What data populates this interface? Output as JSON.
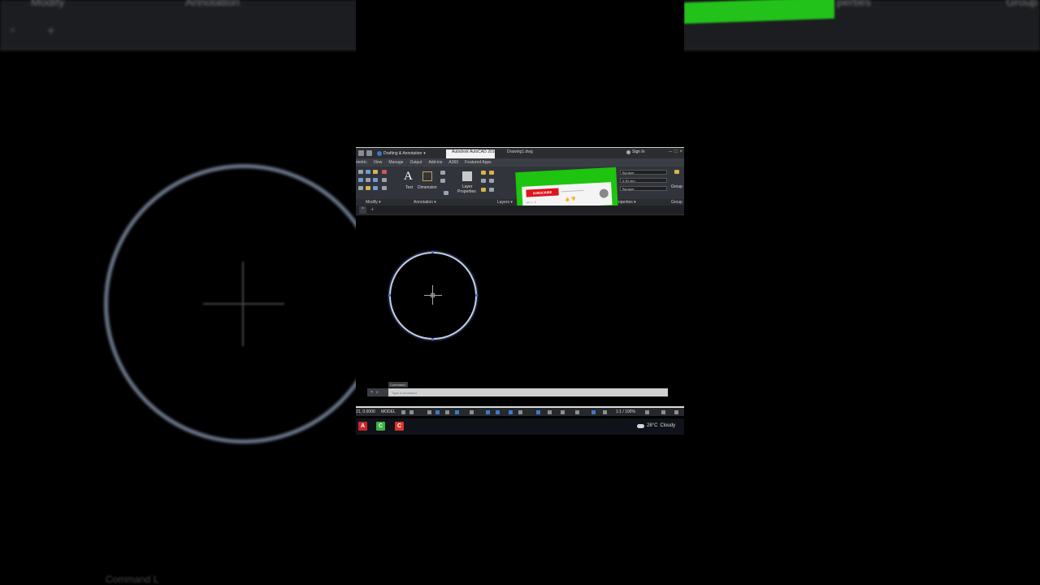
{
  "background": {
    "tabs": [
      "Modify",
      "Annotation",
      "perties",
      "Group"
    ],
    "command_label": "Command L"
  },
  "titlebar": {
    "workspace": "Drafting & Annotation",
    "app_title": "Autodesk AutoCAD 2016",
    "drawing_name": "Drawing1.dwg",
    "sign_in": "Sign In",
    "min": "–",
    "max": "□",
    "close": "×"
  },
  "ribbon_tabs": [
    "metric",
    "View",
    "Manage",
    "Output",
    "Add-ins",
    "A360",
    "Featured Apps"
  ],
  "ribbon": {
    "text_label": "Text",
    "dimension_label": "Dimension",
    "layer_label_1": "Layer",
    "layer_label_2": "Properties",
    "bylayer_1": "ByLayer",
    "lineweight": "0.30 mm",
    "bylayer_2": "ByLayer",
    "group_label": "Group"
  },
  "panel_footer": {
    "modify": "Modify ▾",
    "annotation": "Annotation ▾",
    "layers": "Layers ▾",
    "properties": "Properties ▾",
    "groups": "Group"
  },
  "overlay": {
    "subscribe": "SUBSCRIBE",
    "likes": "👍 👎"
  },
  "command": {
    "label": "Command:",
    "placeholder": "Type a command"
  },
  "statusbar": {
    "coords": "21, 0.0000",
    "model": "MODEL",
    "scale": "1:1 / 100%"
  },
  "taskbar": {
    "weather_temp": "28°C",
    "weather_desc": "Cloudy"
  },
  "colors": {
    "accent_green": "#1ec40f",
    "subscribe_red": "#e1121b",
    "circle_stroke": "#c5ceea"
  }
}
